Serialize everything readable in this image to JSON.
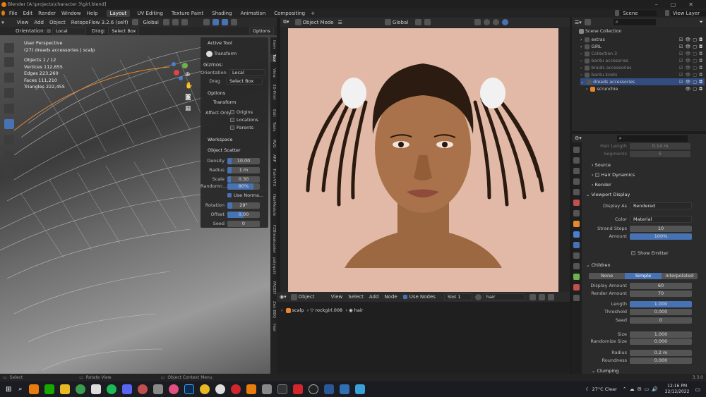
{
  "title": "Blender [A:\\projects\\character 3\\girl.blend]",
  "menu": [
    "File",
    "Edit",
    "Render",
    "Window",
    "Help"
  ],
  "workspaces": [
    "Layout",
    "UV Editing",
    "Texture Paint",
    "Shading",
    "Animation",
    "Compositing"
  ],
  "scene": "Scene",
  "view_layer": "View Layer",
  "left_header": {
    "items": [
      "View",
      "Add",
      "Object"
    ],
    "addon": "RetopoFlow 3.2.6 (self)",
    "transform": "Global",
    "orientation_label": "Orientation:",
    "orientation": "Local",
    "drag_label": "Drag:",
    "drag": "Select Box",
    "options": "Options"
  },
  "viewport_info": {
    "perspective": "User Perspective",
    "collection": "(27) dreads accessories | scalp",
    "objects": "Objects   1 / 12",
    "vertices": "Vertices   112,655",
    "edges": "Edges   223,260",
    "faces": "Faces   111,210",
    "triangles": "Triangles   222,455"
  },
  "tool_panel": {
    "active_tool": "Active Tool",
    "transform": "Transform",
    "gizmos": "Gizmos:",
    "orientation_label": "Orientation",
    "orientation": "Local",
    "drag_label": "Drag",
    "drag": "Select Box",
    "options": "Options",
    "transform2": "Transform",
    "affect_only": "Affect Only",
    "origins": "Origins",
    "locations": "Locations",
    "parents": "Parents",
    "workspace": "Workspace",
    "object_scatter": "Object Scatter",
    "density_label": "Density",
    "density": "10.00",
    "radius_label": "Radius",
    "radius": "1 m",
    "scale_label": "Scale",
    "scale": "0.30",
    "random_label": "Randomn...",
    "random": "80%",
    "use_normal": "Use Norma...",
    "rotation_label": "Rotation",
    "rotation": "29°",
    "offset_label": "Offset",
    "offset": "0.00",
    "seed_label": "Seed",
    "seed": "0"
  },
  "side_tabs": [
    "Item",
    "Tool",
    "View",
    "3D-Print",
    "Edit",
    "Tools",
    "RVG",
    "ARP",
    "Train-VFX",
    "HairModule",
    "FZBroadcaster",
    "polyquilt",
    "FACEIT",
    "Zen BBQ",
    "Hair"
  ],
  "render_header": {
    "mode": "Object Mode",
    "transform": "Global"
  },
  "node_header": {
    "mode": "Object",
    "items": [
      "View",
      "Select",
      "Add",
      "Node"
    ],
    "use_nodes": "Use Nodes",
    "slot": "Slot 1",
    "material": "hair"
  },
  "node_breadcrumb": [
    "scalp",
    "rockgirl.008",
    "hair"
  ],
  "outliner": {
    "root": "Scene Collection",
    "items": [
      "extras",
      "GIRL",
      "Collection 3",
      "bantu accesories",
      "braids accessories",
      "bantu knots",
      "dreads accessories",
      "scrunchie"
    ]
  },
  "properties": {
    "hair_length_label": "Hair Length",
    "hair_length": "0.14 m",
    "segments_label": "Segments",
    "segments": "5",
    "source": "Source",
    "hair_dynamics": "Hair Dynamics",
    "render": "Render",
    "viewport_display": "Viewport Display",
    "display_as_label": "Display As",
    "display_as": "Rendered",
    "color_label": "Color",
    "color": "Material",
    "strand_steps_label": "Strand Steps",
    "strand_steps": "10",
    "amount_label": "Amount",
    "amount": "100%",
    "show_emitter": "Show Emitter",
    "children": "Children",
    "child_modes": [
      "None",
      "Simple",
      "Interpolated"
    ],
    "display_amount_label": "Display Amount",
    "display_amount": "60",
    "render_amount_label": "Render Amount",
    "render_amount": "70",
    "length_label": "Length",
    "length": "1.000",
    "threshold_label": "Threshold",
    "threshold": "0.000",
    "seed_label": "Seed",
    "seed": "0",
    "size_label": "Size",
    "size": "1.000",
    "randomize_size_label": "Randomize Size",
    "randomize_size": "0.000",
    "radius_label": "Radius",
    "radius": "0.2 m",
    "roundness_label": "Roundness",
    "roundness": "0.000",
    "clumping": "Clumping"
  },
  "status_bar": {
    "select": "Select",
    "rotate": "Rotate View",
    "context": "Object Context Menu",
    "version": "3.3.0"
  },
  "taskbar": {
    "weather": "27°C  Clear",
    "time": "12:16 PM",
    "date": "22/12/2022"
  },
  "colors": {
    "accent": "#4772b3",
    "bg": "#1d1d1d",
    "panel": "#2b2b2b",
    "render_bg": "#e2b9a6"
  }
}
